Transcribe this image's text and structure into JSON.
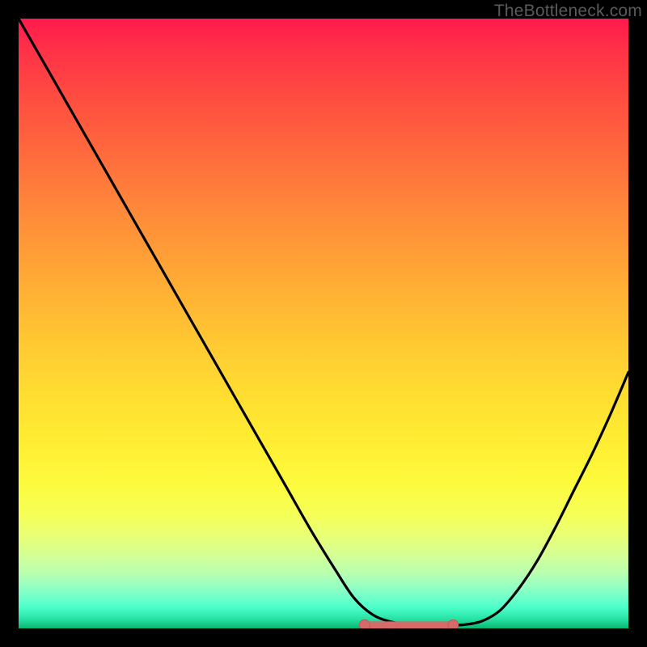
{
  "watermark": "TheBottleneck.com",
  "colors": {
    "curve_stroke": "#000000",
    "marker_fill": "#d66a6a",
    "marker_stroke": "#c05858",
    "frame": "#000000"
  },
  "chart_data": {
    "type": "line",
    "title": "",
    "xlabel": "",
    "ylabel": "",
    "xlim": [
      0,
      100
    ],
    "ylim": [
      0,
      100
    ],
    "x": [
      0,
      4,
      8,
      12,
      16,
      20,
      24,
      28,
      32,
      36,
      40,
      44,
      48,
      52,
      55,
      58,
      61,
      64,
      67,
      70,
      73,
      76,
      79,
      82,
      85,
      88,
      91,
      94,
      97,
      100
    ],
    "values": [
      100,
      93.0,
      86.0,
      79.0,
      72.0,
      65.0,
      58.0,
      51.0,
      44.0,
      37.0,
      30.0,
      23.0,
      16.0,
      9.5,
      5.0,
      2.3,
      1.1,
      0.6,
      0.5,
      0.5,
      0.6,
      1.2,
      3.0,
      6.5,
      11.0,
      16.5,
      22.5,
      28.5,
      35.0,
      42.0
    ],
    "flat_marker": {
      "x_range": [
        57,
        71
      ],
      "y": 0.55
    }
  }
}
